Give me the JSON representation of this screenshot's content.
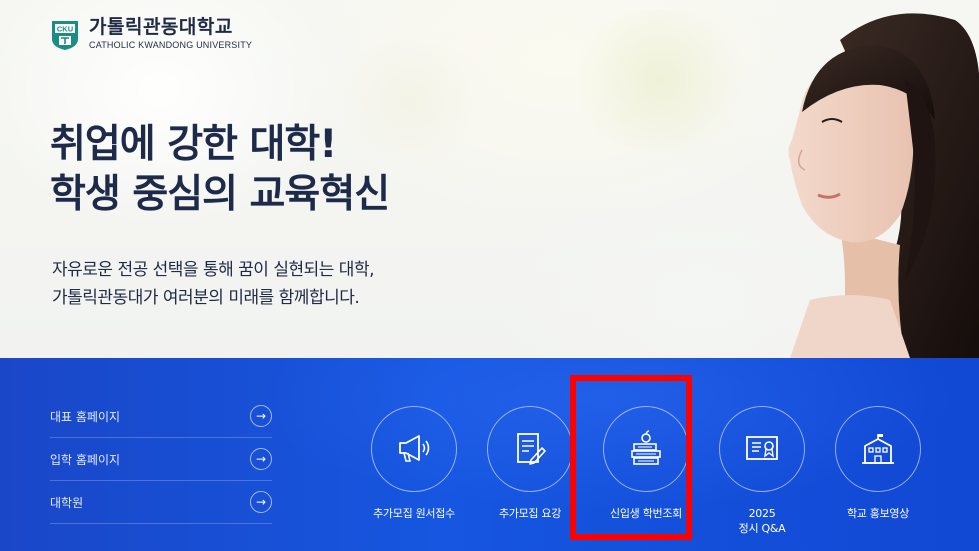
{
  "logo": {
    "emblem_top": "CKU",
    "name_kr": "가톨릭관동대학교",
    "name_en": "CATHOLIC KWANDONG UNIVERSITY"
  },
  "hero": {
    "headline_line1": "취업에 강한 대학!",
    "headline_line2": "학생 중심의 교육혁신",
    "sub_line1": "자유로운 전공 선택을 통해 꿈이 실현되는 대학,",
    "sub_line2": "가톨릭관동대가 여러분의 미래를 함께합니다."
  },
  "quick_links": [
    {
      "label": "대표 홈페이지",
      "icon": "arrow-right-icon"
    },
    {
      "label": "입학 홈페이지",
      "icon": "arrow-right-icon"
    },
    {
      "label": "대학원",
      "icon": "arrow-right-icon"
    }
  ],
  "menu": [
    {
      "label": "추가모집 원서접수",
      "icon": "megaphone-icon"
    },
    {
      "label": "추가모집 요강",
      "icon": "document-pen-icon"
    },
    {
      "label": "신입생 학번조회",
      "icon": "books-apple-icon"
    },
    {
      "label_line1": "2025",
      "label_line2": "정시 Q&A",
      "icon": "certificate-icon"
    },
    {
      "label": "학교 홍보영상",
      "icon": "building-icon"
    }
  ],
  "colors": {
    "band": "#1656e0",
    "text_dark": "#1d2a4a",
    "highlight": "#ff0000",
    "logo_teal": "#1c8c86"
  }
}
